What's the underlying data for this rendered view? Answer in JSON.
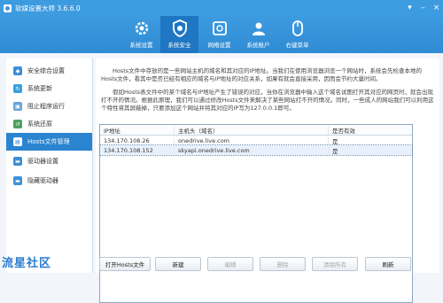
{
  "window": {
    "title": "软媒设置大师 3.6.6.0"
  },
  "toolbar": {
    "items": [
      {
        "label": "系统设置",
        "icon": "gear-icon"
      },
      {
        "label": "系统安全",
        "icon": "shield-icon"
      },
      {
        "label": "网络设置",
        "icon": "network-icon"
      },
      {
        "label": "系统账户",
        "icon": "user-icon"
      },
      {
        "label": "右键菜单",
        "icon": "mouse-icon"
      }
    ]
  },
  "sidebar": {
    "items": [
      {
        "label": "安全综合设置",
        "color": "#3a8fd8"
      },
      {
        "label": "系统更新",
        "color": "#39a0e0"
      },
      {
        "label": "阻止程序运行",
        "color": "#6aa5d8"
      },
      {
        "label": "系统还原",
        "color": "#4aa060"
      },
      {
        "label": "Hosts文件管理",
        "color": "#ffffff"
      },
      {
        "label": "驱动器设置",
        "color": "#3d8fd6"
      },
      {
        "label": "隐藏驱动器",
        "color": "#3d8fd6"
      }
    ]
  },
  "content": {
    "paragraph1": "Hosts文件中存放的是一些网站主机的域名和其对应的IP地址。当我们在使用浏览器浏览一个网站时，系统会先检查本地的Hosts文件，看其中是否已经有相应的域名与IP地址的对应关系，如果有就会直接采用，因而会节约大量时间。",
    "paragraph2": "假如Hosts表文件中的某个域名与IP地址产生了错误的对应，当你在浏览器中输入这个域名试图打开其对应的网页时，就会出现打不开的情况。根据此原理，我们可以通过修改Hosts文件来解决了某些网站打不开的情况。同时，一些成人的网站我们可以利用这个特性将其屏蔽掉，只要添加这个网站并将其对应的IP写为127.0.0.1即可。"
  },
  "table": {
    "headers": [
      "IP地址",
      "主机头（域名）",
      "是否有效"
    ],
    "rows": [
      {
        "ip": "134.170.108.26",
        "host": "onedrive.live.com",
        "valid": "是"
      },
      {
        "ip": "134.170.108.152",
        "host": "skyapi.onedrive.live.com",
        "valid": "是"
      }
    ]
  },
  "buttons": {
    "open": "打开Hosts文件",
    "new": "新建",
    "edit": "编辑",
    "delete": "删除",
    "clear": "清除所有",
    "refresh": "刷新"
  },
  "watermark": "流星社区",
  "colors": {
    "accent": "#3d9be0",
    "active": "#1f76c2"
  }
}
